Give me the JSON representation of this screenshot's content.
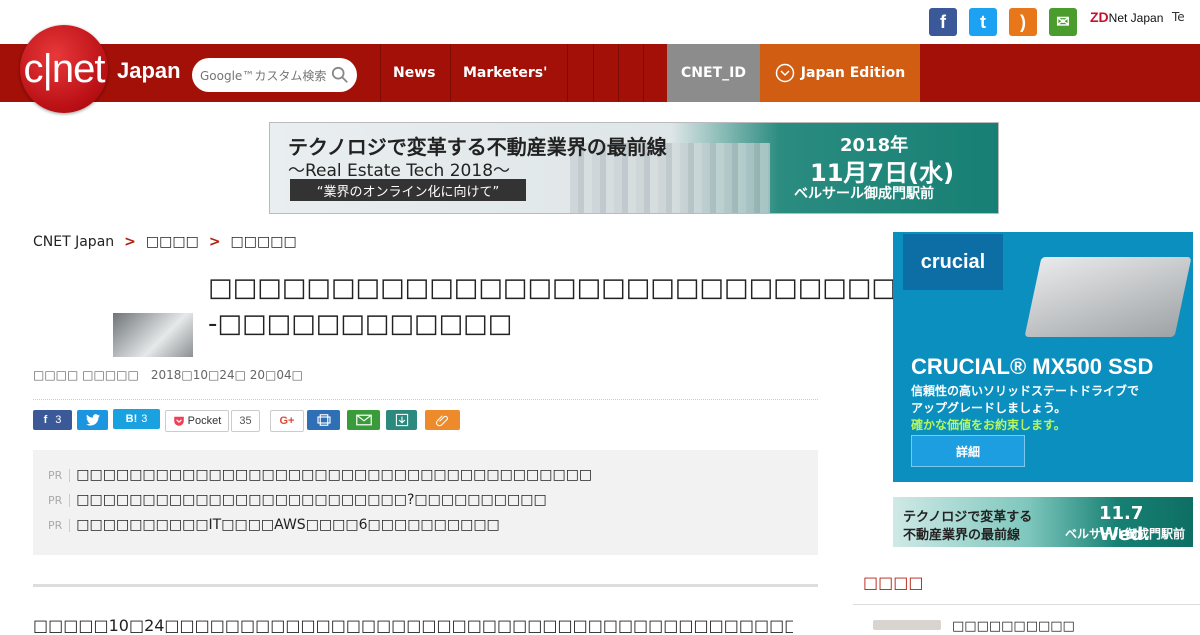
{
  "social": {
    "facebook_glyph": "f",
    "twitter_glyph": "t",
    "rss_glyph": ")",
    "mail_glyph": "✉",
    "zdnet_label": "Net Japan",
    "zdnet_prefix": "ZD",
    "te_label": "Te"
  },
  "header": {
    "logo_text": "c|net",
    "logo_sub": "Japan",
    "search_placeholder": "Google™カスタム検索",
    "nav": {
      "news": "News",
      "marketers": "Marketers'",
      "cnet_id": "CNET_ID",
      "japan_edition": "Japan Edition"
    },
    "colors": {
      "header_red": "#a31008",
      "cnet_id_bg": "#8c8c8c",
      "edition_bg": "#d05d12"
    }
  },
  "banner": {
    "title": "テクノロジで変革する不動産業界の最前線",
    "subtitle": "〜Real Estate Tech 2018〜",
    "tagline": "“業界のオンライン化に向けて”",
    "date_year": "2018年",
    "date_day": "11月7日(水)",
    "venue": "ベルサール御成門駅前"
  },
  "breadcrumb": {
    "home": "CNET Japan",
    "sep": ">",
    "level1": "□□□□",
    "level2": "□□□□□"
  },
  "article": {
    "headline": "□□□□□□□□□□□□□□□□□□□□□□□□□□□□□□□□□--□□□□□□□□□□□□",
    "byline": "□□□□ □□□□□　2018□10□24□ 20□04□",
    "body": "□□□□□10□24□□□□□□□□□□□□□□□□□□□□□□□□□□□□□□□□□□□□□□□□□□□□",
    "body_link": "□□□□□□□□□□□□□□□□"
  },
  "share": {
    "facebook_count": "3",
    "hatena_label": "B!",
    "hatena_count": "3",
    "pocket_label": "Pocket",
    "pocket_count": "35",
    "gplus_label": "G+"
  },
  "pr": {
    "tag": "PR",
    "items": [
      "□□□□□□□□□□□□□□□□□□□□□□□□□□□□□□□□□□□□□□□",
      "□□□□□□□□□□□□□□□□□□□□□□□□□?□□□□□□□□□□",
      "□□□□□□□□□□IT□□□□AWS□□□□6□□□□□□□□□□"
    ]
  },
  "sidebar": {
    "crucial": {
      "brand": "crucial",
      "headline": "CRUCIAL® MX500 SSD",
      "line1": "信頼性の高いソリッドステートドライブで",
      "line2": "アップグレードしましょう。",
      "line3": "確かな価値をお約束します。",
      "button": "詳細"
    },
    "small_ad": {
      "line1": "テクノロジで変革する",
      "line2": "不動産業界の最前線",
      "date": "11.7 Wed.",
      "venue": "ベルサール御成門駅前"
    },
    "section_title": "□□□□",
    "item_text": "□□□□□□□□□□"
  }
}
